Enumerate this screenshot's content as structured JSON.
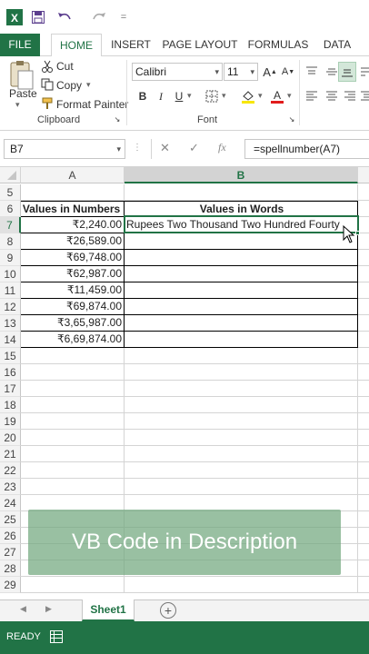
{
  "titlebar": {
    "app_icon": "excel-logo-icon",
    "customize_glyph": "="
  },
  "menu": {
    "file": "FILE",
    "home": "HOME",
    "insert": "INSERT",
    "page_layout": "PAGE LAYOUT",
    "formulas": "FORMULAS",
    "data": "DATA"
  },
  "clipboard": {
    "paste": "Paste",
    "cut": "Cut",
    "copy": "Copy",
    "format_painter": "Format Painter",
    "group_label": "Clipboard"
  },
  "font": {
    "family": "Calibri",
    "size": "11",
    "bold": "B",
    "italic": "I",
    "underline": "U",
    "grow": "A",
    "shrink": "A",
    "group_label": "Font"
  },
  "formula_bar": {
    "name_box": "B7",
    "cancel": "✕",
    "enter": "✓",
    "fx": "fx",
    "formula": "=spellnumber(A7)"
  },
  "columns": {
    "a": "A",
    "b": "B"
  },
  "header_row": {
    "num": "6",
    "a": "Values in Numbers",
    "b": "Values in Words"
  },
  "rows": [
    {
      "num": "5",
      "a": "",
      "b": ""
    },
    {
      "num": "7",
      "a": "₹2,240.00",
      "b": "Rupees Two Thousand Two Hundred Fourty"
    },
    {
      "num": "8",
      "a": "₹26,589.00",
      "b": ""
    },
    {
      "num": "9",
      "a": "₹69,748.00",
      "b": ""
    },
    {
      "num": "10",
      "a": "₹62,987.00",
      "b": ""
    },
    {
      "num": "11",
      "a": "₹11,459.00",
      "b": ""
    },
    {
      "num": "12",
      "a": "₹69,874.00",
      "b": ""
    },
    {
      "num": "13",
      "a": "₹3,65,987.00",
      "b": ""
    },
    {
      "num": "14",
      "a": "₹6,69,874.00",
      "b": ""
    },
    {
      "num": "15"
    },
    {
      "num": "16"
    },
    {
      "num": "17"
    },
    {
      "num": "18"
    },
    {
      "num": "19"
    },
    {
      "num": "20"
    },
    {
      "num": "21"
    },
    {
      "num": "22"
    },
    {
      "num": "23"
    },
    {
      "num": "24"
    },
    {
      "num": "25"
    },
    {
      "num": "26"
    },
    {
      "num": "27"
    },
    {
      "num": "28"
    },
    {
      "num": "29"
    }
  ],
  "overlay_text": "VB Code in Description",
  "sheet_tab": "Sheet1",
  "add_sheet": "+",
  "status": "READY",
  "colors": {
    "accent": "#217346",
    "overlay": "#71a87e"
  }
}
